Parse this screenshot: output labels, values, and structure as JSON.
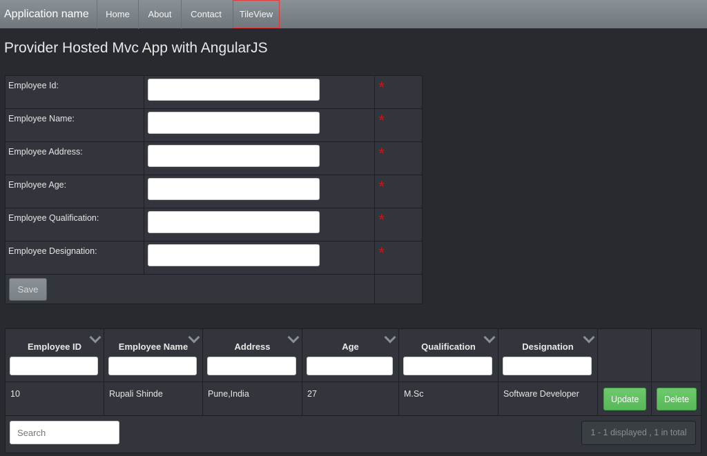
{
  "navbar": {
    "brand": "Application name",
    "items": [
      {
        "label": "Home"
      },
      {
        "label": "About"
      },
      {
        "label": "Contact"
      },
      {
        "label": "TileView"
      }
    ],
    "active_color": "#e23a3a"
  },
  "page": {
    "title": "Provider Hosted Mvc App with AngularJS"
  },
  "form": {
    "fields": [
      {
        "label": "Employee Id:",
        "value": "",
        "required_mark": "*"
      },
      {
        "label": "Employee Name:",
        "value": "",
        "required_mark": "*"
      },
      {
        "label": "Employee Address:",
        "value": "",
        "required_mark": "*"
      },
      {
        "label": "Employee Age:",
        "value": "",
        "required_mark": "*"
      },
      {
        "label": "Employee Qualification:",
        "value": "",
        "required_mark": "*"
      },
      {
        "label": "Employee Designation:",
        "value": "",
        "required_mark": "*"
      }
    ],
    "save_label": "Save"
  },
  "grid": {
    "columns": [
      {
        "label": "Employee ID"
      },
      {
        "label": "Employee Name"
      },
      {
        "label": "Address"
      },
      {
        "label": "Age"
      },
      {
        "label": "Qualification"
      },
      {
        "label": "Designation"
      }
    ],
    "rows": [
      {
        "id": "10",
        "name": "Rupali Shinde",
        "address": "Pune,India",
        "age": "27",
        "qualification": "M.Sc",
        "designation": "Software Developer",
        "update_label": "Update",
        "delete_label": "Delete"
      }
    ],
    "search_placeholder": "Search",
    "pager_info": "1 - 1 displayed , 1 in total"
  },
  "colors": {
    "background": "#272b30",
    "required": "#ff0000",
    "button_green": "#62c462"
  }
}
